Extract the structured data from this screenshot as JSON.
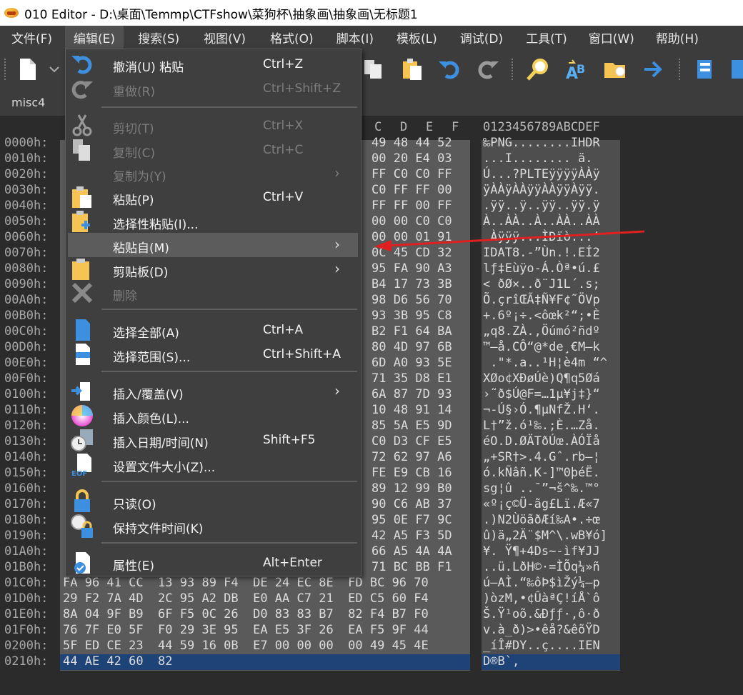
{
  "window": {
    "title": "010 Editor - D:\\桌面\\Temmp\\CTFshow\\菜狗杯\\抽象画\\抽象画\\无标题1"
  },
  "menubar": [
    "文件(F)",
    "编辑(E)",
    "搜索(S)",
    "视图(V)",
    "格式(O)",
    "脚本(I)",
    "模板(L)",
    "调试(D)",
    "工具(T)",
    "窗口(W)",
    "帮助(H)"
  ],
  "tab": {
    "name": "misc4"
  },
  "edit_menu": {
    "items": [
      {
        "label": "撤消(U) 粘贴",
        "shortcut": "Ctrl+Z",
        "enabled": true,
        "icon": "undo-icon"
      },
      {
        "label": "重做(R)",
        "shortcut": "Ctrl+Shift+Z",
        "enabled": false,
        "icon": "redo-icon"
      },
      {
        "label": "剪切(T)",
        "shortcut": "Ctrl+X",
        "enabled": false,
        "icon": "scissors-icon"
      },
      {
        "label": "复制(C)",
        "shortcut": "Ctrl+C",
        "enabled": false,
        "icon": "copy-icon"
      },
      {
        "label": "复制为(Y)",
        "shortcut": "",
        "enabled": false,
        "submenu": true
      },
      {
        "label": "粘贴(P)",
        "shortcut": "Ctrl+V",
        "enabled": true,
        "icon": "paste-icon"
      },
      {
        "label": "选择性粘贴(I)...",
        "shortcut": "",
        "enabled": true,
        "icon": "paste-special-icon"
      },
      {
        "label": "粘贴自(M)",
        "shortcut": "",
        "enabled": true,
        "submenu": true,
        "highlighted": true
      },
      {
        "label": "剪贴板(D)",
        "shortcut": "",
        "enabled": true,
        "submenu": true,
        "icon": "clipboard-icon"
      },
      {
        "label": "删除",
        "shortcut": "",
        "enabled": false,
        "icon": "delete-icon"
      },
      {
        "label": "选择全部(A)",
        "shortcut": "Ctrl+A",
        "enabled": true,
        "icon": "select-all-icon"
      },
      {
        "label": "选择范围(S)...",
        "shortcut": "Ctrl+Shift+A",
        "enabled": true,
        "icon": "select-range-icon"
      },
      {
        "label": "插入/覆盖(V)",
        "shortcut": "",
        "enabled": true,
        "submenu": true,
        "icon": "insert-overwrite-icon"
      },
      {
        "label": "插入颜色(L)...",
        "shortcut": "",
        "enabled": true,
        "icon": "color-wheel-icon"
      },
      {
        "label": "插入日期/时间(N)",
        "shortcut": "Shift+F5",
        "enabled": true,
        "icon": "calendar-clock-icon"
      },
      {
        "label": "设置文件大小(Z)...",
        "shortcut": "",
        "enabled": true,
        "icon": "file-size-icon"
      },
      {
        "label": "只读(O)",
        "shortcut": "",
        "enabled": true,
        "icon": "lock-icon"
      },
      {
        "label": "保持文件时间(K)",
        "shortcut": "",
        "enabled": true,
        "icon": "clock-lock-icon"
      },
      {
        "label": "属性(E)",
        "shortcut": "Alt+Enter",
        "enabled": true,
        "icon": "properties-icon"
      }
    ]
  },
  "hex": {
    "col_headers": [
      "C",
      "D",
      "E",
      "F"
    ],
    "ascii_header": "0123456789ABCDEF",
    "rows": [
      {
        "addr": "0000h:",
        "hex": "49 48 44 52",
        "ascii": "‰PNG........IHDR"
      },
      {
        "addr": "0010h:",
        "hex": "00 20 E4 03",
        "ascii": "...I........ ä."
      },
      {
        "addr": "0020h:",
        "hex": "FF C0 C0 FF",
        "ascii": "Ú...?PLTEÿÿÿÿÀÀÿ"
      },
      {
        "addr": "0030h:",
        "hex": "C0 FF FF 00",
        "ascii": "ÿÀÀÿÀÀÿÿÀÀÿÿÀÿÿ."
      },
      {
        "addr": "0040h:",
        "hex": "FF FF 00 FF",
        "ascii": ".ÿÿ..ÿ..ÿÿ..ÿÿ.ÿ"
      },
      {
        "addr": "0050h:",
        "hex": "00 00 C0 C0",
        "ascii": "À..ÀÀ..À..ÀÀ..ÀÀ"
      },
      {
        "addr": "0060h:",
        "hex": "00 00 01 91",
        "ascii": " Àÿÿÿ...ÌDïò...‘"
      },
      {
        "addr": "0070h:",
        "hex": "0C 45 CD 32",
        "ascii": "IDAT8.-”Ùn.!.EÍ2"
      },
      {
        "addr": "0080h:",
        "hex": "95 FA 90 A3",
        "ascii": "lƒ‡Eùÿo-Á.Òª•ú.£"
      },
      {
        "addr": "0090h:",
        "hex": "B4 17 73 3B",
        "ascii": "< ðØ×..ð¨J1L´.s;"
      },
      {
        "addr": "00A0h:",
        "hex": "98 D6 56 70",
        "ascii": "Õ.çrîŒÃ‡Ñ¥F¢˜ÖVp"
      },
      {
        "addr": "00B0h:",
        "hex": "93 3B 95 C8",
        "ascii": "+.6º¡÷.<ôœk²“;•È"
      },
      {
        "addr": "00C0h:",
        "hex": "B2 F1 64 BA",
        "ascii": "„q8.ZÀ.,Öúmó²ñdº"
      },
      {
        "addr": "00D0h:",
        "hex": "80 4D 97 6B",
        "ascii": "™–å.CÔ“@*de¸€M—k"
      },
      {
        "addr": "00E0h:",
        "hex": "6D A0 93 5E",
        "ascii": " .\"*.a..¹H¦è4m “^"
      },
      {
        "addr": "00F0h:",
        "hex": "71 35 D8 E1",
        "ascii": "XØo¢XÐøÚè)Q¶q5Øá"
      },
      {
        "addr": "0100h:",
        "hex": "6A 87 7D 93",
        "ascii": "›˜ð$Ú@F=…1µ¥j‡}“"
      },
      {
        "addr": "0110h:",
        "hex": "10 48 91 14",
        "ascii": "¬-Ú§›Ó.¶µNfŽ.H‘."
      },
      {
        "addr": "0120h:",
        "hex": "85 5A E5 9D",
        "ascii": "L†”ž.ó¹‰.;È.…Zå."
      },
      {
        "addr": "0130h:",
        "hex": "C0 D3 CF E5",
        "ascii": "éO.D.ØÄTðÚœ.ÀÓÏå"
      },
      {
        "addr": "0140h:",
        "hex": "72 62 97 A6",
        "ascii": "„+SR†>.4.Gˆ.rb—¦"
      },
      {
        "addr": "0150h:",
        "hex": "FE E9 CB 16",
        "ascii": "ó.kÑâñ.K-]™0þéË."
      },
      {
        "addr": "0160h:",
        "hex": "89 12 99 B0",
        "ascii": "sg¦û ..¯”¬š^‰.™°"
      },
      {
        "addr": "0170h:",
        "hex": "90 C6 AB 37",
        "ascii": "«º¡ç©Ü-ãg£Lï.Æ«7"
      },
      {
        "addr": "0180h:",
        "hex": "95 0E F7 9C",
        "ascii": ".)N2ÙöãðÆí‰A•.÷œ"
      },
      {
        "addr": "0190h:",
        "hex": "42 A5 F3 5D",
        "ascii": "û)ä„2Ä¨$M^\\.wB¥ó]"
      },
      {
        "addr": "01A0h:",
        "hex": "66 A5 4A 4A",
        "ascii": "¥. Ÿ¶+4Ds~-ìf¥JJ"
      },
      {
        "addr": "01B0h:",
        "hex": "71 BC BB F1",
        "ascii": "..ü.LðH©·=ÌÕq¼»ñ"
      },
      {
        "addr": "01C0h:",
        "hex": "FA 96 41 CC  13 93 89 F4  DE 24 EC 8E  FD BC 96 70",
        "ascii": "ú–AÌ.“‰ôÞ$ìŽý¼–p"
      },
      {
        "addr": "01D0h:",
        "hex": "29 F2 7A 4D  2C 95 A2 DB  E0 AA C7 21  ED C5 60 F4",
        "ascii": ")òzM,•¢ÛàªÇ!íÅ`ô"
      },
      {
        "addr": "01E0h:",
        "hex": "8A 04 9F B9  6F F5 0C 26  D0 83 83 B7  82 F4 B7 F0",
        "ascii": "Š.Ÿ¹oõ.&Ðƒƒ·‚ô·ð"
      },
      {
        "addr": "01F0h:",
        "hex": "76 7F E0 5F  F0 29 3E 95  EA E5 3F 26  EA F5 9F 44",
        "ascii": "v.à_ð)>•êå?&êõŸD"
      },
      {
        "addr": "0200h:",
        "hex": "5F ED CE 23  44 59 16 0B  E7 00 00 00  00 49 45 4E",
        "ascii": "_íÎ#DY..ç....IEN"
      },
      {
        "addr": "0210h:",
        "hex": "44 AE 42 60  82",
        "ascii": "D®B`‚"
      }
    ]
  }
}
